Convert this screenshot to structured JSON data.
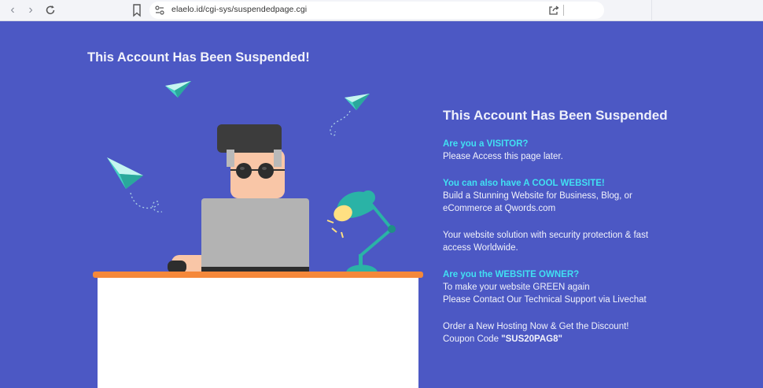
{
  "browser": {
    "url": "elaelo.id/cgi-sys/suspendedpage.cgi",
    "icons": [
      "back-icon",
      "forward-icon",
      "reload-icon",
      "bookmark-icon",
      "site-info-icon",
      "share-icon"
    ]
  },
  "page": {
    "left_title": "This Account Has Been Suspended!",
    "panel": {
      "title": "This Account Has Been Suspended",
      "visitor": {
        "heading": "Are you a VISITOR?",
        "text": "Please Access this page later."
      },
      "cool": {
        "heading": "You can also have A COOL WEBSITE!",
        "line1": "Build a Stunning Website for Business, Blog, or",
        "line2": "eCommerce at Qwords.com"
      },
      "solution": {
        "line1": "Your website solution with security protection & fast",
        "line2": "access Worldwide."
      },
      "owner": {
        "heading": "Are you the WEBSITE OWNER?",
        "line1": "To make your website GREEN again",
        "line2": "Please Contact Our Technical Support via Livechat"
      },
      "order": {
        "line1": "Order a New Hosting Now & Get the Discount!",
        "coupon_label": "Coupon Code ",
        "coupon_code": "\"SUS20PAG8\""
      }
    },
    "colors": {
      "background": "#4c58c4",
      "highlight": "#41e0f2",
      "desk_top": "#f5883a",
      "laptop": "#b3b3b3",
      "lamp": "#2ab3a6"
    }
  }
}
